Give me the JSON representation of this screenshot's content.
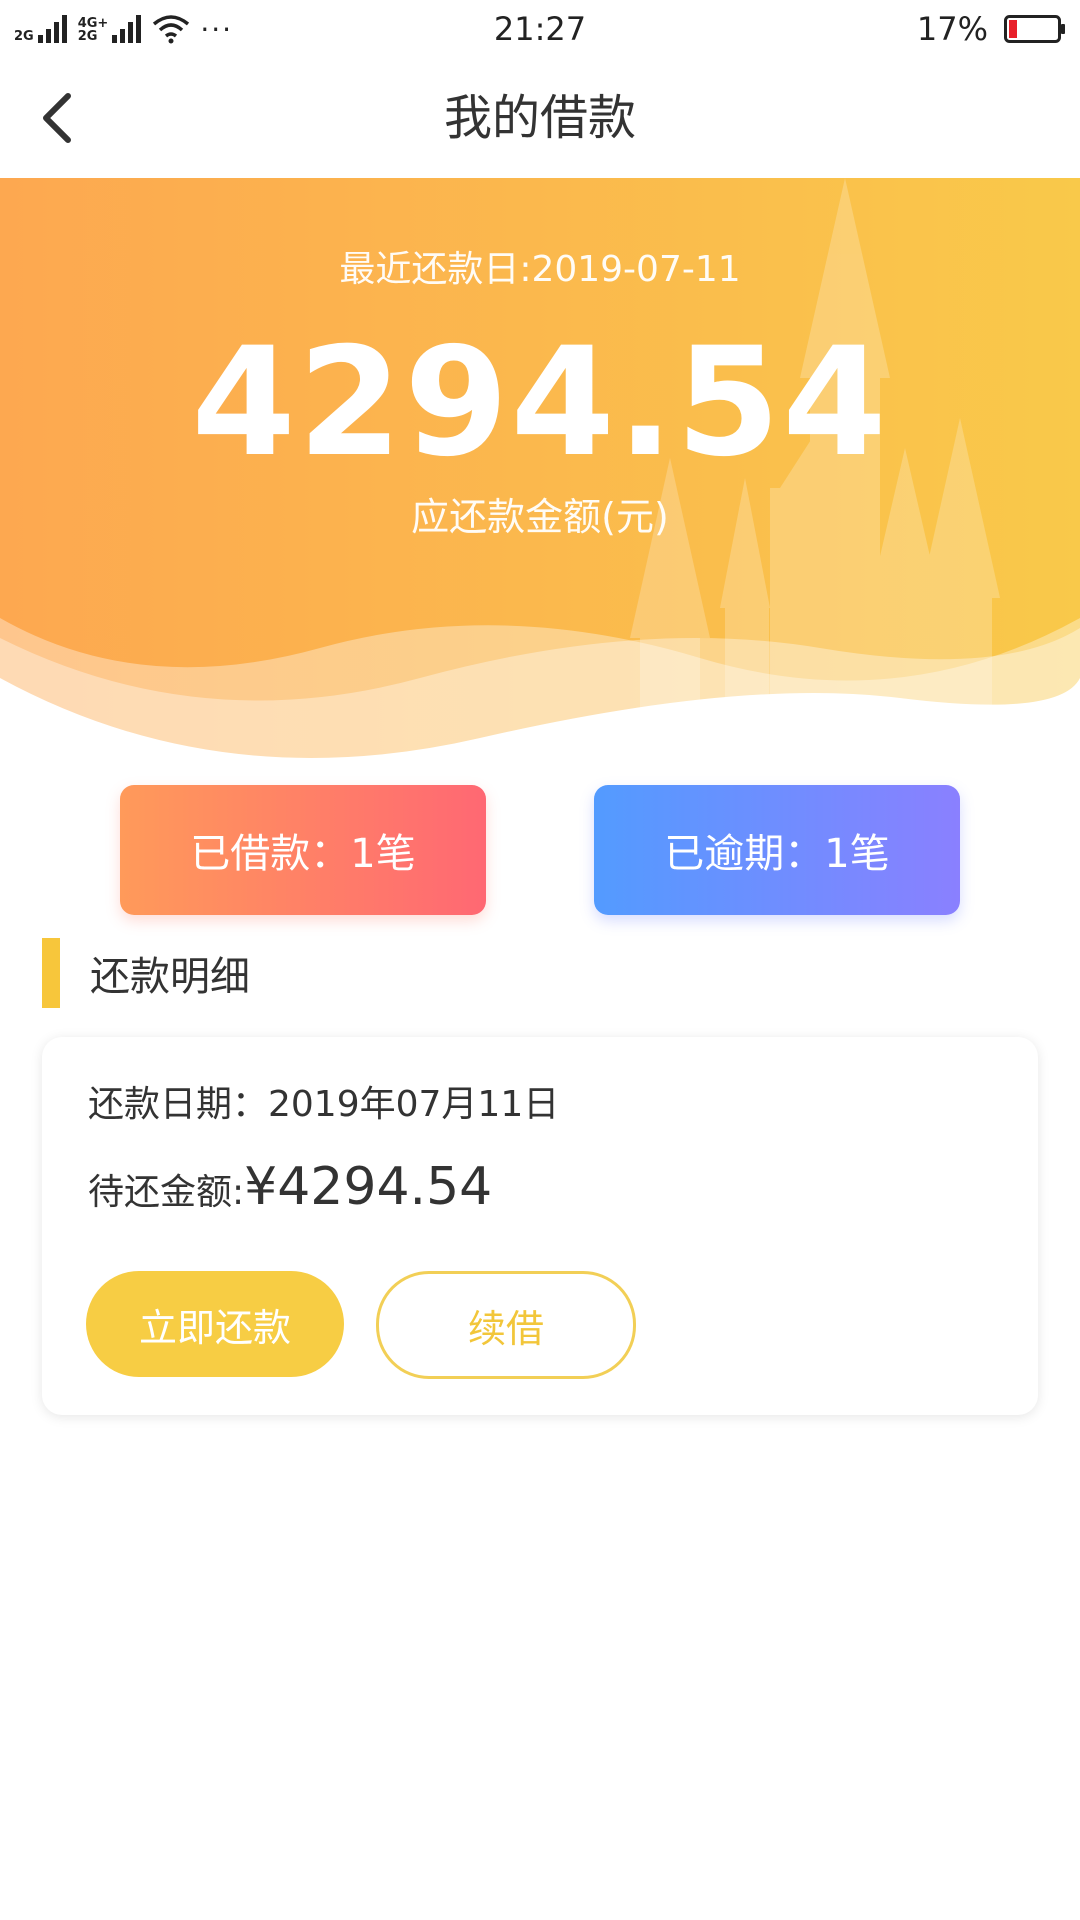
{
  "status_bar": {
    "network_1": "2G",
    "network_2_top": "4G+",
    "network_2_bottom": "2G",
    "more": "···",
    "time": "21:27",
    "battery_percent": "17%",
    "battery_level": 0.17,
    "battery_color": "#e8202a"
  },
  "nav": {
    "back_icon": "chevron-left-icon",
    "title": "我的借款"
  },
  "hero": {
    "next_repay_date": "最近还款日:2019-07-11",
    "amount": "4294.54",
    "caption": "应还款金额(元)",
    "gradient_start": "#fda850",
    "gradient_end": "#f9c94a"
  },
  "stats": {
    "borrowed": "已借款：1笔",
    "overdue": "已逾期：1笔"
  },
  "section": {
    "title": "还款明细",
    "accent": "#f7c63b"
  },
  "repay_card": {
    "date_text": "还款日期：2019年07月11日",
    "amount_label": "待还金额:",
    "amount_value": "¥4294.54",
    "pay_now_label": "立即还款",
    "renew_label": "续借"
  }
}
